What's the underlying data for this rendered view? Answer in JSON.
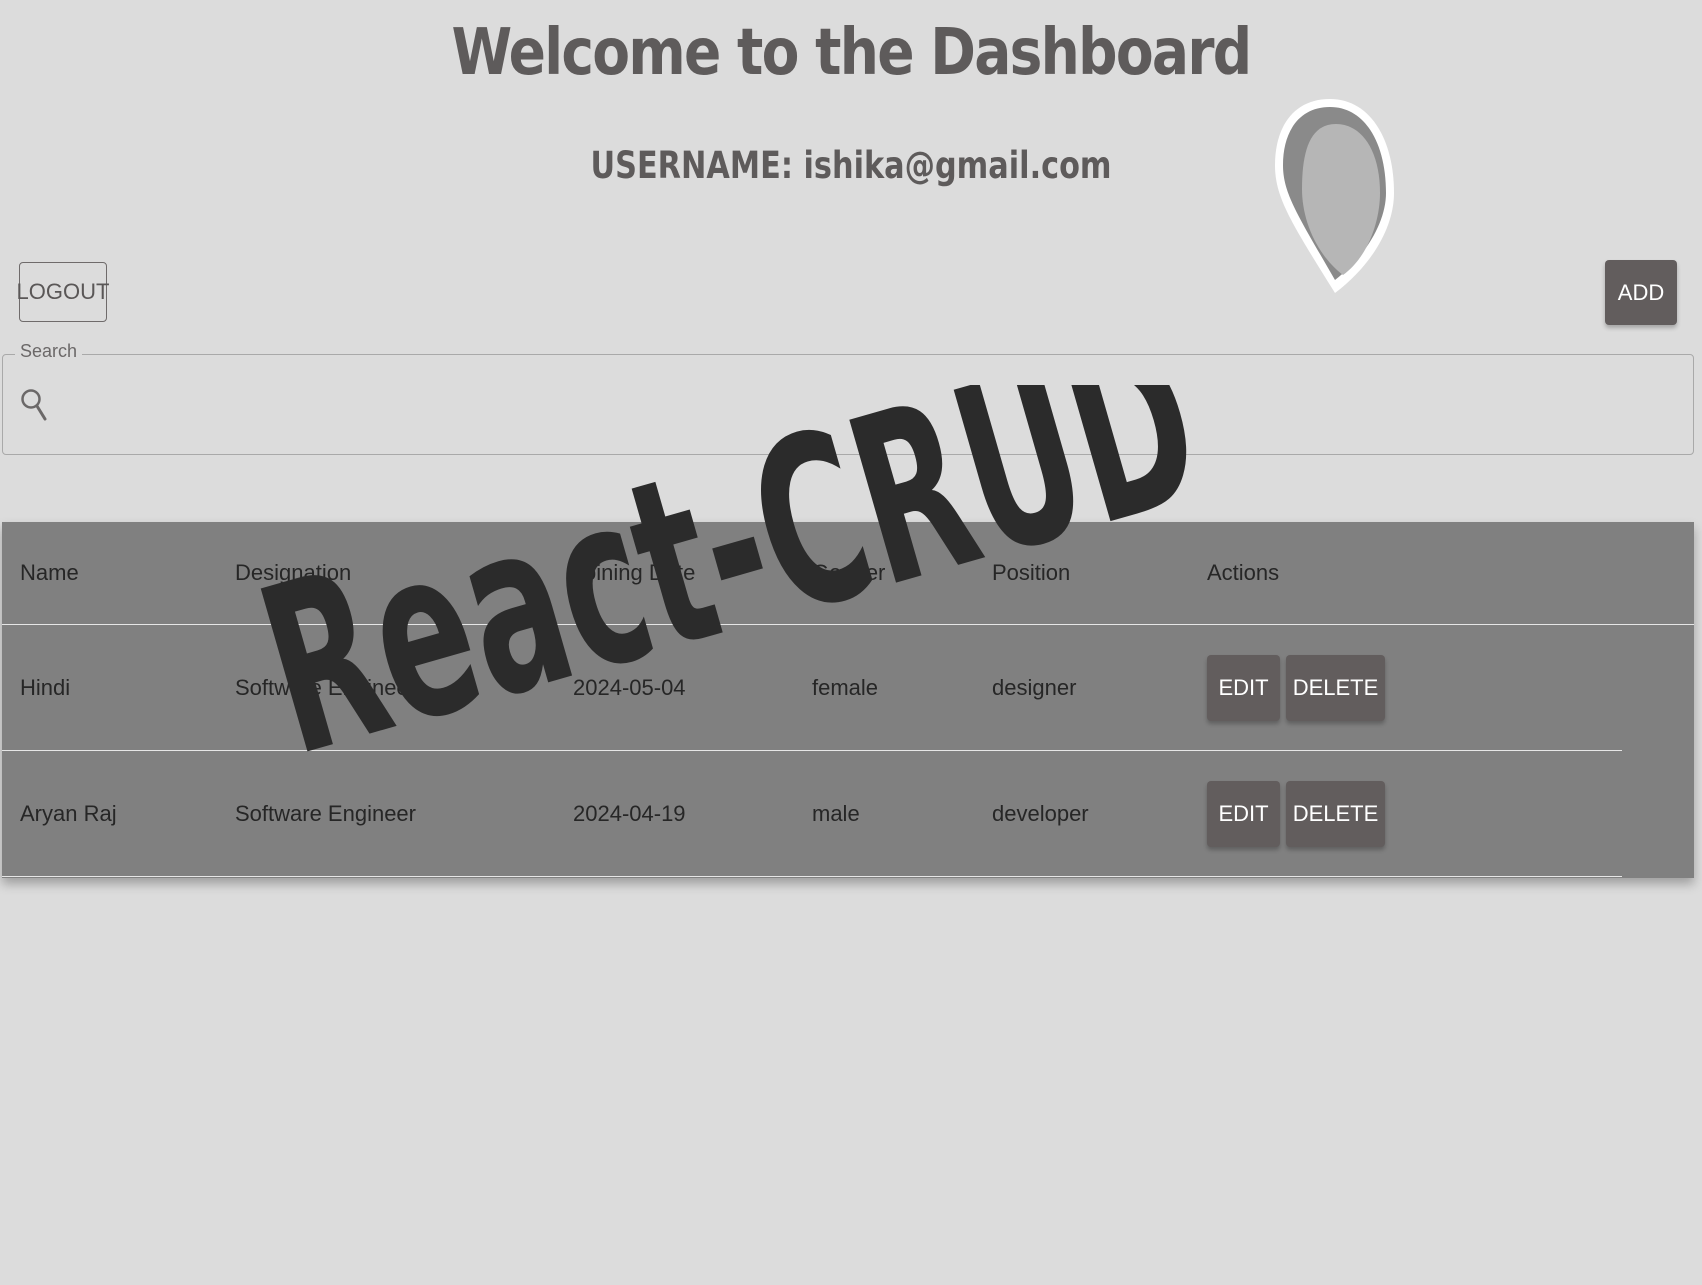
{
  "header": {
    "title": "Welcome to the Dashboard",
    "username_label": "USERNAME: ishika@gmail.com"
  },
  "toolbar": {
    "logout_label": "LOGOUT",
    "add_label": "ADD"
  },
  "search": {
    "label": "Search",
    "value": "",
    "icon": "search-icon"
  },
  "table": {
    "columns": [
      "Name",
      "Designation",
      "Joining Date",
      "Gender",
      "Position",
      "Actions"
    ],
    "rows": [
      {
        "name": "Hindi",
        "designation": "Software Engineer",
        "joining_date": "2024-05-04",
        "gender": "female",
        "position": "designer",
        "edit_label": "EDIT",
        "delete_label": "DELETE"
      },
      {
        "name": "Aryan Raj",
        "designation": "Software Engineer",
        "joining_date": "2024-04-19",
        "gender": "male",
        "position": "developer",
        "edit_label": "EDIT",
        "delete_label": "DELETE"
      }
    ]
  },
  "watermark": {
    "text": "React-CRUD"
  },
  "colors": {
    "background": "#dcdcdc",
    "button": "#625d5d",
    "table": "#808080",
    "watermark": "#2b2b2b"
  }
}
